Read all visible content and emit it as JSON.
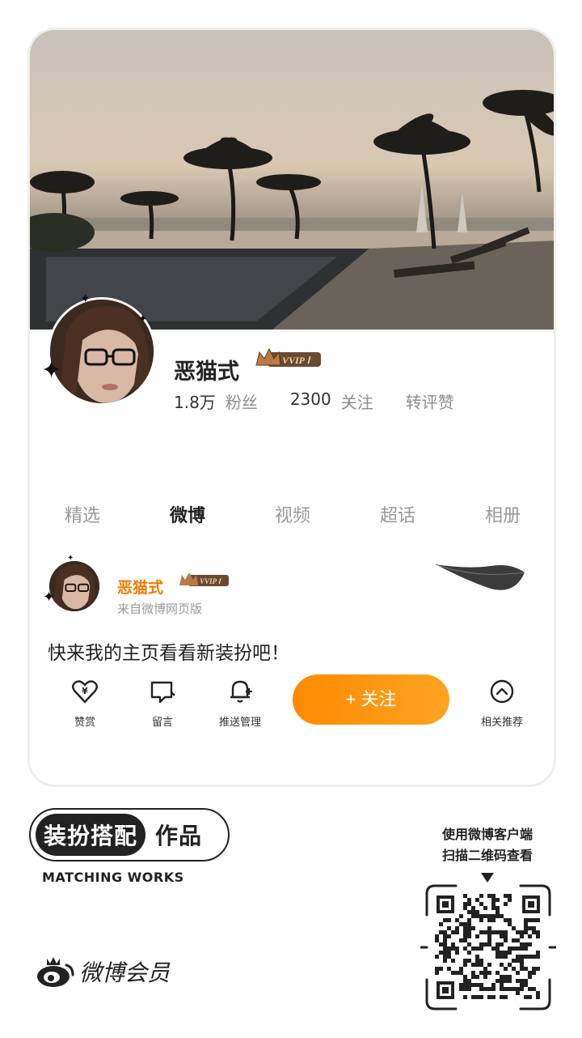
{
  "profile": {
    "username": "恶猫式",
    "vip_label": "VVIP Ⅰ",
    "followers_count": "1.8万",
    "followers_label": "粉丝",
    "following_count": "2300",
    "following_label": "关注",
    "interactions_label": "转评赞"
  },
  "tabs": [
    {
      "label": "精选",
      "active": false
    },
    {
      "label": "微博",
      "active": true
    },
    {
      "label": "视频",
      "active": false
    },
    {
      "label": "超话",
      "active": false
    },
    {
      "label": "相册",
      "active": false
    }
  ],
  "post": {
    "author": "恶猫式",
    "vip_label": "VVIP Ⅰ",
    "source": "来自微博网页版",
    "text": "快来我的主页看看新装扮吧！"
  },
  "actions": {
    "reward": "赞赏",
    "comment": "留言",
    "push": "推送管理",
    "follow": "+ 关注",
    "recommend": "相关推荐"
  },
  "footer": {
    "badge_dark": "装扮搭配",
    "badge_light": "作品",
    "subtitle": "MATCHING WORKS",
    "brand": "微博会员",
    "scan_line1": "使用微博客户端",
    "scan_line2": "扫描二维码查看"
  },
  "colors": {
    "accent_orange": "#ff8a00",
    "name_orange": "#f07c00",
    "text_dark": "#222222",
    "text_gray": "#9a9a9a"
  },
  "icons": [
    "reward-icon",
    "comment-icon",
    "bell-icon",
    "chevron-up-icon",
    "weibo-logo-icon",
    "qr-code"
  ]
}
